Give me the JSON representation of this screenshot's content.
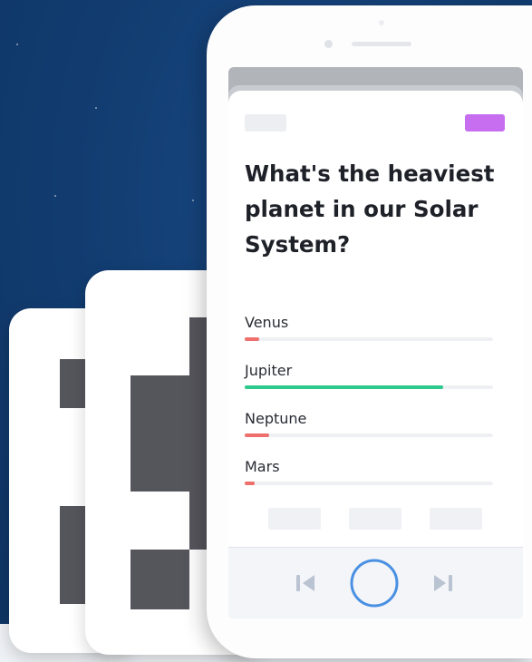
{
  "quiz": {
    "question": "What's the heaviest planet in our Solar System?",
    "answers": [
      {
        "label": "Venus",
        "share": 0.06,
        "status": "wrong"
      },
      {
        "label": "Jupiter",
        "share": 0.8,
        "status": "correct"
      },
      {
        "label": "Neptune",
        "share": 0.1,
        "status": "wrong"
      },
      {
        "label": "Mars",
        "share": 0.04,
        "status": "wrong"
      }
    ]
  },
  "controls": {
    "prev_icon": "skip-back-icon",
    "play_icon": "play-circle-icon",
    "next_icon": "skip-forward-icon"
  },
  "colors": {
    "background": "#123e73",
    "tag_accent": "#c76ef0",
    "correct": "#2ec98c",
    "wrong": "#ef6f6c",
    "control_accent": "#4a90e2",
    "control_muted": "#b9c3d1"
  }
}
